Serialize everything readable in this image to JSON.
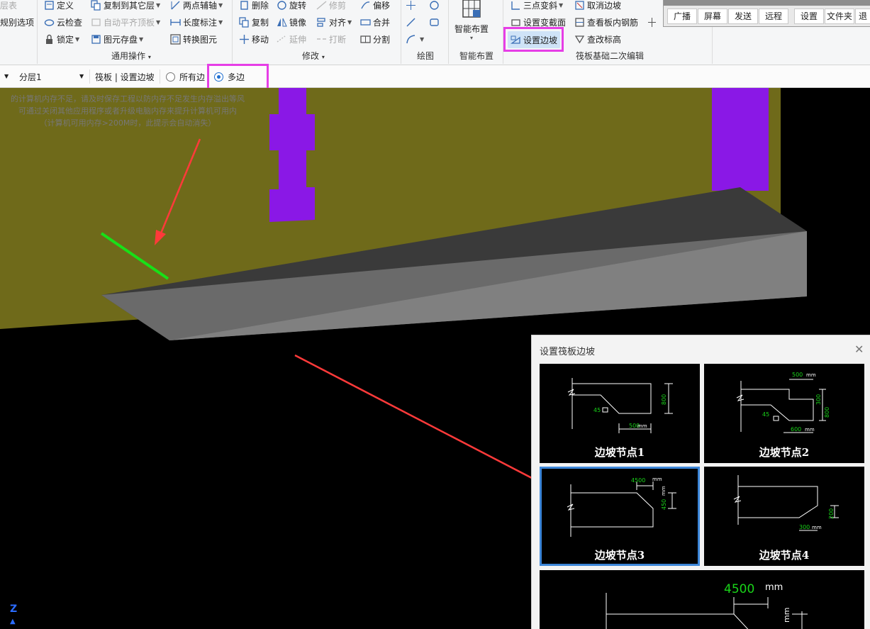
{
  "ribbon": {
    "g1": {
      "layer_table": "层表",
      "class_options": "规别选项"
    },
    "g2": {
      "define": "定义",
      "cloud_check": "云检查",
      "lock": "锁定",
      "copy_to_layer": "复制到其它层",
      "auto_flush": "自动平齐顶板",
      "element_save": "图元存盘",
      "two_point_axis": "两点辅轴",
      "length_dim": "长度标注",
      "convert_element": "转换图元",
      "label": "通用操作"
    },
    "g3": {
      "delete": "删除",
      "rotate": "旋转",
      "trim": "修剪",
      "offset": "偏移",
      "copy": "复制",
      "mirror": "镜像",
      "align": "对齐",
      "merge": "合并",
      "move": "移动",
      "extend": "延伸",
      "break": "打断",
      "split": "分割",
      "label": "修改"
    },
    "g4": {
      "label": "绘图"
    },
    "g5": {
      "smart_layout": "智能布置",
      "label": "智能布置"
    },
    "g6": {
      "three_point_slope": "三点变斜",
      "cancel_edge_slope": "取消边坡",
      "set_variable_section": "设置变截面",
      "view_slab_rebar": "查看板内钢筋",
      "set_edge_slope": "设置边坡",
      "modify_elevation": "查改标高",
      "label": "筏板基础二次编辑"
    }
  },
  "right_bar": {
    "buttons": [
      "广播",
      "屏幕",
      "发送",
      "远程",
      "设置",
      "文件夹",
      "退"
    ]
  },
  "toolbar2": {
    "layer_select": "分层1",
    "breadcrumb": "筏板 | 设置边坡",
    "radio_all": "所有边",
    "radio_multi": "多边",
    "selected": "多边"
  },
  "memory_warning": [
    "的计算机内存不足，请及时保存工程以防内存不足发生内存溢出等风",
    "可通过关闭其他应用程序或者升级电脑内存来提升计算机可用内",
    "（计算机可用内存>200M时，此提示会自动消失）"
  ],
  "dialog": {
    "title": "设置筏板边坡",
    "nodes": [
      {
        "label": "边坡节点1",
        "dims": [
          "800",
          "45",
          "500",
          "mm"
        ]
      },
      {
        "label": "边坡节点2",
        "dims": [
          "500",
          "mm",
          "300",
          "800",
          "45",
          "600",
          "mm"
        ]
      },
      {
        "label": "边坡节点3",
        "dims": [
          "4500",
          "mm",
          "450",
          "mm"
        ]
      },
      {
        "label": "边坡节点4",
        "dims": [
          "200",
          "300",
          "mm"
        ]
      }
    ],
    "preview": {
      "width_value": "4500",
      "unit": "mm"
    }
  },
  "colors": {
    "highlight": "#e63ee6",
    "wall": "#6f6a1a",
    "column": "#8a18e6",
    "slope_top": "#3a3a3a",
    "slope_front": "#6a6a6a",
    "slope_side": "#808080",
    "green_edge": "#18e018",
    "arrow": "#ff3a3a",
    "dim_green": "#19d419",
    "selected_border": "#3c86d8"
  },
  "icons": [
    "define-icon",
    "cloud-check-icon",
    "lock-icon",
    "copy-layer-icon",
    "delete-icon",
    "rotate-icon",
    "mirror-icon",
    "move-icon",
    "smart-layout-icon",
    "set-slope-icon",
    "close-icon",
    "z-axis-icon"
  ]
}
